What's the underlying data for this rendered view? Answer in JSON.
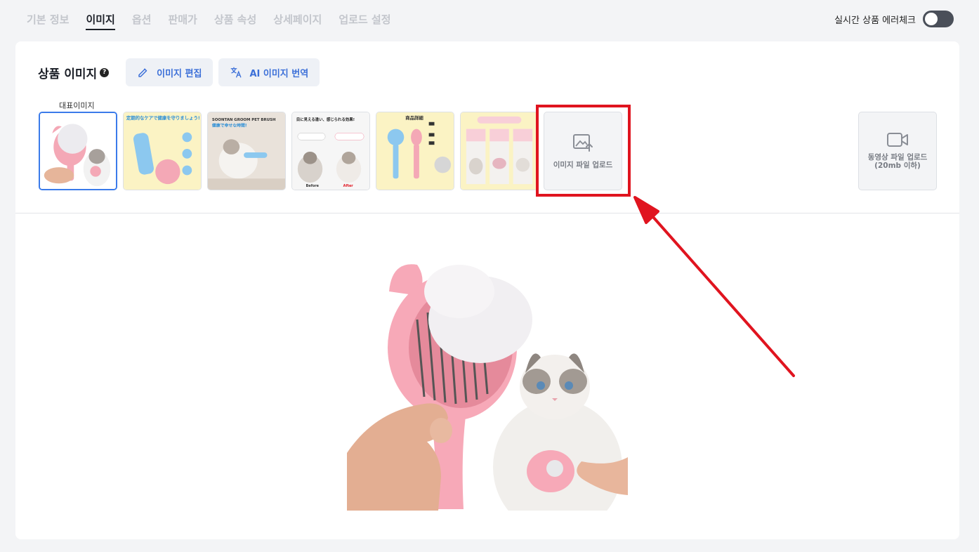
{
  "tabs": [
    {
      "label": "기본 정보",
      "active": false
    },
    {
      "label": "이미지",
      "active": true
    },
    {
      "label": "옵션",
      "active": false
    },
    {
      "label": "판매가",
      "active": false
    },
    {
      "label": "상품 속성",
      "active": false
    },
    {
      "label": "상세페이지",
      "active": false
    },
    {
      "label": "업로드 설정",
      "active": false
    }
  ],
  "error_check": {
    "label": "실시간 상품 에러체크",
    "enabled": false
  },
  "section": {
    "title": "상품 이미지",
    "help": "?",
    "edit_button": "이미지 편집",
    "translate_button": "AI 이미지 번역",
    "representative_label": "대표이미지"
  },
  "thumbnails": [
    {
      "name": "thumbnail-1",
      "selected": true
    },
    {
      "name": "thumbnail-2",
      "selected": false,
      "text": "定期的なケアで健康を守りましょう!"
    },
    {
      "name": "thumbnail-3",
      "selected": false,
      "text": "SOONTAN GROOM PET BRUSH",
      "subtext": "健康で幸せな時間!"
    },
    {
      "name": "thumbnail-4",
      "selected": false,
      "text": "目に見える違い、感じられる効果!",
      "before": "Before",
      "after": "After"
    },
    {
      "name": "thumbnail-5",
      "selected": false,
      "text": "商品詳細"
    },
    {
      "name": "thumbnail-6",
      "selected": false
    }
  ],
  "upload": {
    "label": "이미지 파일 업로드"
  },
  "video_upload": {
    "line1": "동영상 파일 업로드",
    "line2": "(20mb 이하)"
  },
  "colors": {
    "accent": "#3b6fd8",
    "highlight": "#e0141f",
    "brush_pink": "#f7a9b8"
  }
}
